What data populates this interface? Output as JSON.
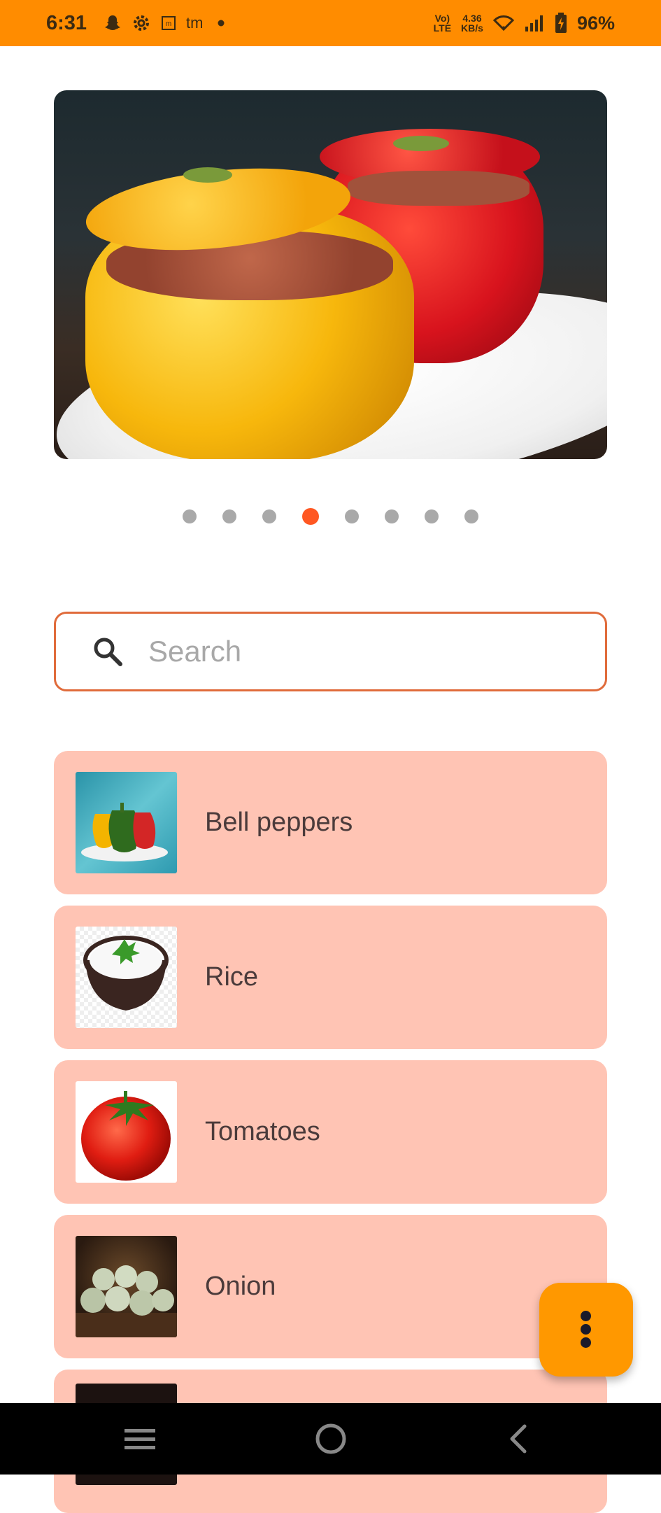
{
  "status_bar": {
    "time": "6:31",
    "notification_icons": [
      "snapchat-icon",
      "settings-icon",
      "mi-icon",
      "tm-icon"
    ],
    "volte_line1": "Vo)",
    "volte_line2": "LTE",
    "speed_line1": "4.36",
    "speed_line2": "KB/s",
    "battery": "96%"
  },
  "carousel": {
    "page_count": 8,
    "active_index": 3
  },
  "search": {
    "placeholder": "Search",
    "value": ""
  },
  "ingredients": [
    {
      "label": "Bell peppers",
      "image": "bell-peppers-thumbnail"
    },
    {
      "label": "Rice",
      "image": "rice-thumbnail"
    },
    {
      "label": "Tomatoes",
      "image": "tomato-thumbnail"
    },
    {
      "label": "Onion",
      "image": "onion-thumbnail"
    }
  ],
  "fab": {
    "icon": "more-vertical-icon"
  },
  "nav": {
    "icons": [
      "menu-icon",
      "home-icon",
      "back-icon"
    ]
  },
  "colors": {
    "status_bar": "#FF8C00",
    "accent": "#FF5722",
    "list_item_bg": "#FFC4B4",
    "fab": "#FF9800"
  }
}
